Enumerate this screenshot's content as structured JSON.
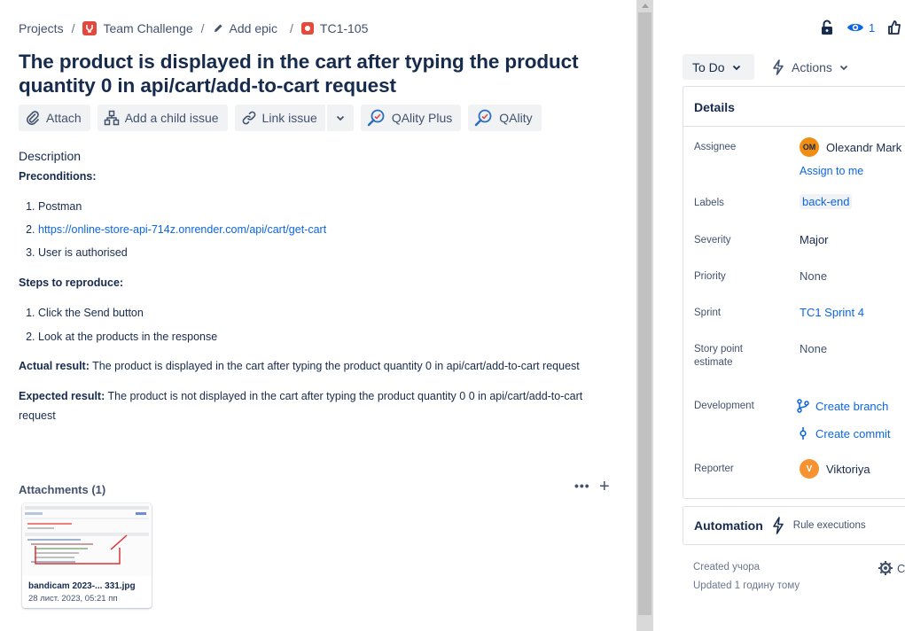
{
  "breadcrumb": {
    "projects": "Projects",
    "project": "Team Challenge",
    "epic": "Add epic",
    "issue_key": "TC1-105",
    "separator": "/"
  },
  "issue": {
    "title": "The product is displayed in the cart after typing the product quantity 0 in api/cart/add-to-cart request"
  },
  "toolbar": {
    "attach": "Attach",
    "add_child": "Add a child issue",
    "link_issue": "Link issue",
    "qality_plus": "QAlity Plus",
    "qality": "QAlity"
  },
  "description": {
    "label": "Description",
    "preconditions_heading": "Preconditions:",
    "preconditions": [
      "Postman",
      "https://online-store-api-714z.onrender.com/api/cart/get-cart",
      "User is authorised"
    ],
    "steps_heading": "Steps to reproduce:",
    "steps": [
      "Click the Send button",
      "Look at the products in the response"
    ],
    "actual_label": "Actual result:",
    "actual_text": " The product is displayed in the cart after typing the product quantity 0 in api/cart/add-to-cart request",
    "expected_label": "Expected result:",
    "expected_text": " The product is not displayed in the cart after typing the product quantity 0 0 in api/cart/add-to-cart request"
  },
  "attachments": {
    "label": "Attachments (1)",
    "more": "•••",
    "add": "+",
    "file_name": "bandicam 2023-... 331.jpg",
    "file_date": "28 лист. 2023, 05:21 пп"
  },
  "header_right": {
    "watch_count": "1"
  },
  "status": {
    "current": "To Do",
    "actions": "Actions"
  },
  "details": {
    "heading": "Details",
    "assignee_label": "Assignee",
    "assignee_initials": "OM",
    "assignee_name": "Olexandr Mark",
    "assign_to_me": "Assign to me",
    "labels_label": "Labels",
    "labels_value": "back-end",
    "severity_label": "Severity",
    "severity_value": "Major",
    "priority_label": "Priority",
    "priority_value": "None",
    "sprint_label": "Sprint",
    "sprint_value": "TC1 Sprint 4",
    "story_label": "Story point estimate",
    "story_value": "None",
    "development_label": "Development",
    "create_branch": "Create branch",
    "create_commit": "Create commit",
    "reporter_label": "Reporter",
    "reporter_initial": "V",
    "reporter_name": "Viktoriya"
  },
  "automation": {
    "title": "Automation",
    "subtitle": "Rule executions"
  },
  "meta": {
    "created": "Created учора",
    "updated": "Updated 1 годину тому",
    "configure": "C"
  },
  "colors": {
    "link": "#0c66e4",
    "text": "#172b4d",
    "bug": "#e5493a",
    "button_bg": "#f1f2f4"
  }
}
